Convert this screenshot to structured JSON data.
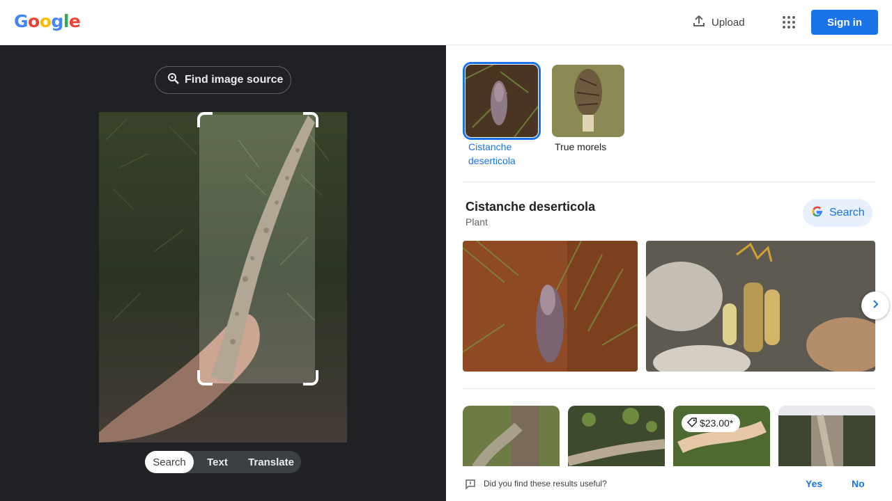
{
  "header": {
    "logo_letters": [
      {
        "char": "G",
        "color": "#4285f4"
      },
      {
        "char": "o",
        "color": "#ea4335"
      },
      {
        "char": "o",
        "color": "#fbbc05"
      },
      {
        "char": "g",
        "color": "#4285f4"
      },
      {
        "char": "l",
        "color": "#34a853"
      },
      {
        "char": "e",
        "color": "#ea4335"
      }
    ],
    "upload_label": "Upload",
    "signin_label": "Sign in",
    "accent": "#1a73e8"
  },
  "left_panel": {
    "find_source_label": "Find image source",
    "modes": [
      "Search",
      "Text",
      "Translate"
    ],
    "active_mode": "Search"
  },
  "right_panel": {
    "suggestions": [
      {
        "label": "Cistanche deserticola",
        "selected": true
      },
      {
        "label": "True morels",
        "selected": false
      }
    ],
    "knowledge": {
      "title": "Cistanche deserticola",
      "subtitle": "Plant",
      "search_label": "Search"
    },
    "results": [
      {
        "price": ""
      },
      {
        "price": ""
      },
      {
        "price": "$23.00*"
      },
      {
        "price": ""
      }
    ],
    "feedback": {
      "question": "Did you find these results useful?",
      "yes": "Yes",
      "no": "No"
    }
  }
}
